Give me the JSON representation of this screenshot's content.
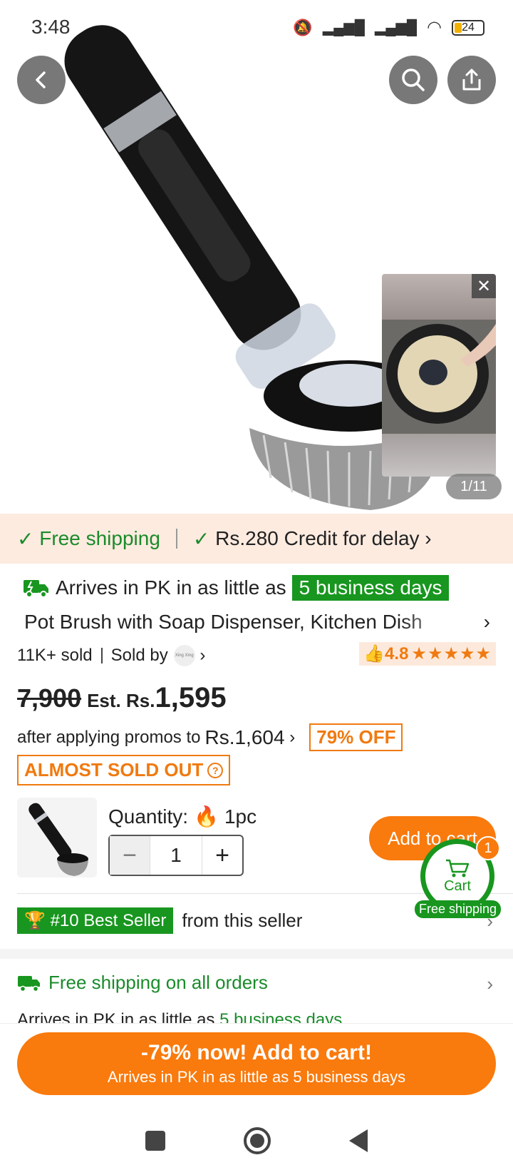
{
  "status_bar": {
    "time": "3:48",
    "battery": "24"
  },
  "hero": {
    "image_counter": "1/11"
  },
  "shipping_bar": {
    "free_shipping": "Free shipping",
    "credit": "Rs.280 Credit for delay"
  },
  "delivery": {
    "prefix": "Arrives in PK in as little as",
    "badge": "5 business days"
  },
  "product": {
    "title": "Pot Brush with Soap Dispenser, Kitchen Dish",
    "sold": "11K+ sold",
    "sold_by": "Sold by",
    "seller_logo_text": "Xing Xing",
    "rating": "4.8",
    "stars": "★★★★★"
  },
  "price": {
    "old": "7,900",
    "est_label": "Est. Rs.",
    "new": "1,595",
    "promo_text": "after applying promos to",
    "promo_price": "Rs.1,604",
    "discount": "79% OFF",
    "almost_sold_out": "ALMOST SOLD OUT"
  },
  "quantity": {
    "label": "Quantity:",
    "unit": "1pc",
    "value": "1",
    "add_to_cart": "Add to cart"
  },
  "cart_float": {
    "label": "Cart",
    "count": "1",
    "free_shipping": "Free shipping"
  },
  "best_seller": {
    "badge": "#10 Best Seller",
    "suffix": "from this seller"
  },
  "free_shipping_section": {
    "title": "Free shipping on all orders",
    "sub_prefix": "Arrives in PK in as little as",
    "sub_highlight": "5 business days"
  },
  "cta": {
    "main": "-79% now! Add to cart!",
    "sub": "Arrives in PK in as little as 5 business days"
  },
  "colors": {
    "accent": "#f97a0d",
    "green": "#18961f"
  }
}
